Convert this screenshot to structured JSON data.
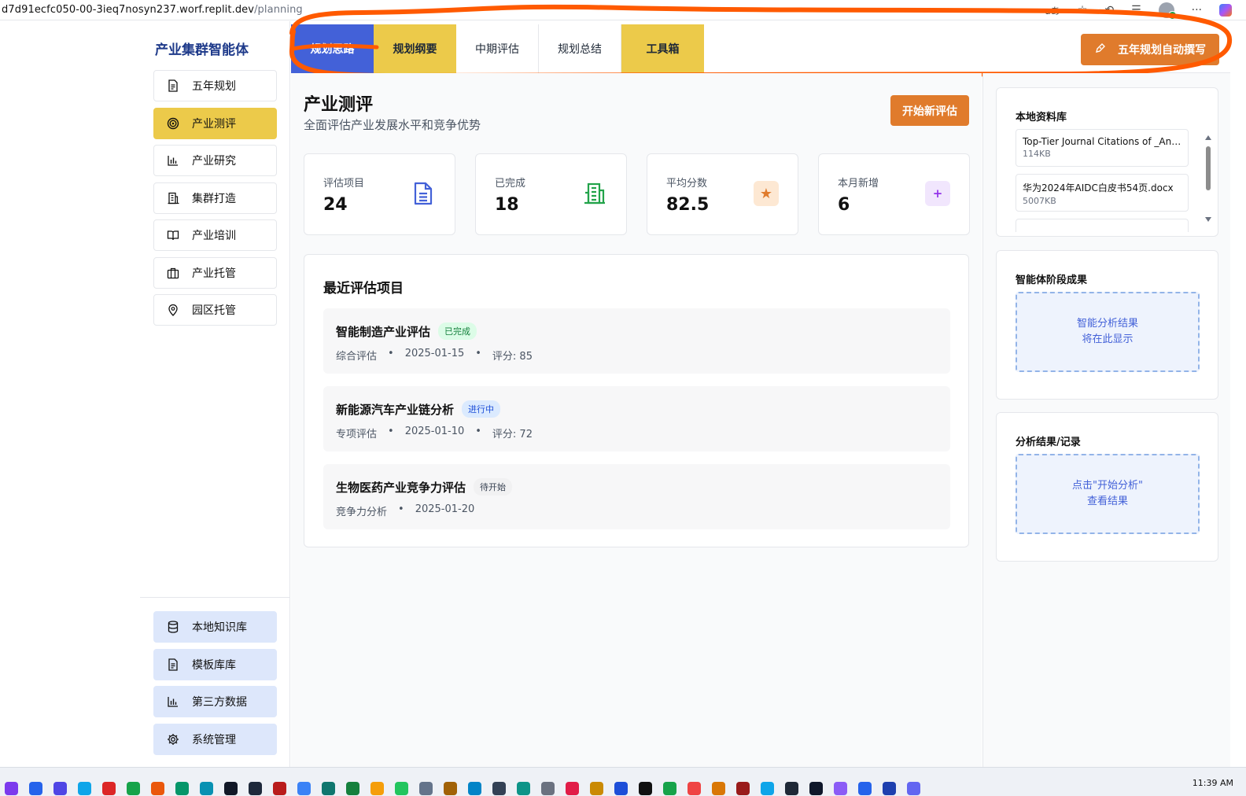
{
  "browser": {
    "url_host": "d7d91ecfc050-00-3ieq7nosyn237.worf.replit.dev",
    "url_path": "/planning",
    "read_aloud": "aあ"
  },
  "sidebar": {
    "brand": "产业集群智能体",
    "items": [
      {
        "label": "五年规划",
        "icon": "document-icon"
      },
      {
        "label": "产业测评",
        "icon": "target-icon",
        "active": true
      },
      {
        "label": "产业研究",
        "icon": "bar-chart-icon"
      },
      {
        "label": "集群打造",
        "icon": "building-icon"
      },
      {
        "label": "产业培训",
        "icon": "book-icon"
      },
      {
        "label": "产业托管",
        "icon": "briefcase-icon"
      },
      {
        "label": "园区托管",
        "icon": "location-pin-icon"
      }
    ],
    "bottom_items": [
      {
        "label": "本地知识库",
        "icon": "database-icon"
      },
      {
        "label": "模板库库",
        "icon": "document-icon"
      },
      {
        "label": "第三方数据",
        "icon": "bar-chart-icon"
      },
      {
        "label": "系统管理",
        "icon": "gear-icon"
      }
    ]
  },
  "topbar": {
    "tabs": [
      {
        "label": "规划思路",
        "style": "blue"
      },
      {
        "label": "规划纲要",
        "style": "yellow"
      },
      {
        "label": "中期评估",
        "style": "plain"
      },
      {
        "label": "规划总结",
        "style": "plain"
      },
      {
        "label": "工具箱",
        "style": "yellow"
      }
    ],
    "auto_write_button": "五年规划自动撰写"
  },
  "main": {
    "title": "产业测评",
    "subtitle": "全面评估产业发展水平和竞争优势",
    "new_button": "开始新评估",
    "stats": [
      {
        "label": "评估项目",
        "value": "24",
        "icon": "document-icon",
        "color": "#4361d8"
      },
      {
        "label": "已完成",
        "value": "18",
        "icon": "building-icon",
        "color": "#22a34a"
      },
      {
        "label": "平均分数",
        "value": "82.5",
        "icon": "star-icon",
        "color": "#e07b2c"
      },
      {
        "label": "本月新增",
        "value": "6",
        "icon": "plus-icon",
        "color": "#9333ea"
      }
    ],
    "recent_title": "最近评估项目",
    "projects": [
      {
        "name": "智能制造产业评估",
        "status": "已完成",
        "status_type": "done",
        "meta": [
          "综合评估",
          "2025-01-15",
          "评分: 85"
        ]
      },
      {
        "name": "新能源汽车产业链分析",
        "status": "进行中",
        "status_type": "doing",
        "meta": [
          "专项评估",
          "2025-01-10",
          "评分: 72"
        ]
      },
      {
        "name": "生物医药产业竞争力评估",
        "status": "待开始",
        "status_type": "wait",
        "meta": [
          "竞争力分析",
          "2025-01-20"
        ]
      }
    ]
  },
  "right": {
    "library_title": "本地资料库",
    "files": [
      {
        "name": "Top-Tier Journal Citations of _An O...",
        "size": "114KB"
      },
      {
        "name": "华为2024年AIDC白皮书54页.docx",
        "size": "5007KB"
      }
    ],
    "stage_title": "智能体阶段成果",
    "stage_placeholder": [
      "智能分析结果",
      "将在此显示"
    ],
    "records_title": "分析结果/记录",
    "records_placeholder": [
      "点击\"开始分析\"",
      "查看结果"
    ]
  },
  "taskbar": {
    "clock": "11:39 AM"
  },
  "annotation_color": "#ff5a00"
}
